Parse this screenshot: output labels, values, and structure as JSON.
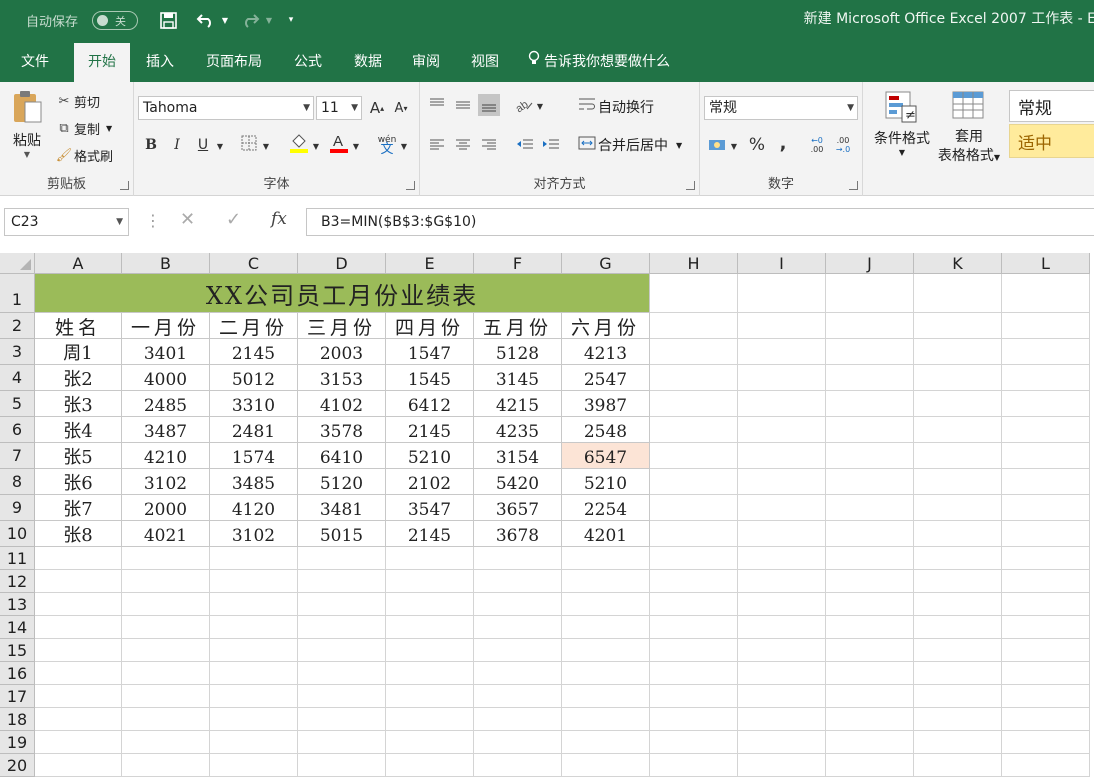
{
  "titlebar": {
    "autosave_label": "自动保存",
    "autosave_state": "关",
    "window_title": "新建 Microsoft Office Excel 2007 工作表 - E",
    "icons": [
      "save-icon",
      "undo-icon",
      "redo-icon",
      "customize-qat-icon"
    ]
  },
  "tabs": [
    "文件",
    "开始",
    "插入",
    "页面布局",
    "公式",
    "数据",
    "审阅",
    "视图"
  ],
  "tell_me": "告诉我你想要做什么",
  "ribbon": {
    "clipboard": {
      "paste": "粘贴",
      "cut": "剪切",
      "copy": "复制",
      "format_painter": "格式刷",
      "label": "剪贴板"
    },
    "font": {
      "family": "Tahoma",
      "size": "11",
      "bold": "B",
      "italic": "I",
      "underline": "U",
      "label": "字体",
      "grow": "A",
      "shrink": "A",
      "phonetic": "wén"
    },
    "alignment": {
      "wrap": "自动换行",
      "merge": "合并后居中",
      "label": "对齐方式"
    },
    "number": {
      "format": "常规",
      "percent": "%",
      "comma": ",",
      "label": "数字"
    },
    "styles": {
      "conditional": "条件格式",
      "table_format_1": "套用",
      "table_format_2": "表格格式",
      "normal": "常规",
      "neutral": "适中"
    }
  },
  "formula_bar": {
    "name_box": "C23",
    "fx": "fx",
    "formula": "B3=MIN($B$3:$G$10)"
  },
  "columns": [
    "A",
    "B",
    "C",
    "D",
    "E",
    "F",
    "G",
    "H",
    "I",
    "J",
    "K",
    "L"
  ],
  "rows": [
    "1",
    "2",
    "3",
    "4",
    "5",
    "6",
    "7",
    "8",
    "9",
    "10",
    "11",
    "12",
    "13",
    "14",
    "15",
    "16",
    "17",
    "18",
    "19",
    "20"
  ],
  "sheet": {
    "title": "XX公司员工月份业绩表",
    "headers": [
      "姓名",
      "一月份",
      "二月份",
      "三月份",
      "四月份",
      "五月份",
      "六月份"
    ],
    "data": [
      [
        "周1",
        "3401",
        "2145",
        "2003",
        "1547",
        "5128",
        "4213"
      ],
      [
        "张2",
        "4000",
        "5012",
        "3153",
        "1545",
        "3145",
        "2547"
      ],
      [
        "张3",
        "2485",
        "3310",
        "4102",
        "6412",
        "4215",
        "3987"
      ],
      [
        "张4",
        "3487",
        "2481",
        "3578",
        "2145",
        "4235",
        "2548"
      ],
      [
        "张5",
        "4210",
        "1574",
        "6410",
        "5210",
        "3154",
        "6547"
      ],
      [
        "张6",
        "3102",
        "3485",
        "5120",
        "2102",
        "5420",
        "5210"
      ],
      [
        "张7",
        "2000",
        "4120",
        "3481",
        "3547",
        "3657",
        "2254"
      ],
      [
        "张8",
        "4021",
        "3102",
        "5015",
        "2145",
        "3678",
        "4201"
      ]
    ],
    "highlight": {
      "row": 4,
      "col": 6,
      "color": "#fce4d6"
    },
    "title_fill": "#9bbb59"
  },
  "colors": {
    "ribbon_green": "#217346",
    "ribbon_bg": "#f3f3f3"
  }
}
